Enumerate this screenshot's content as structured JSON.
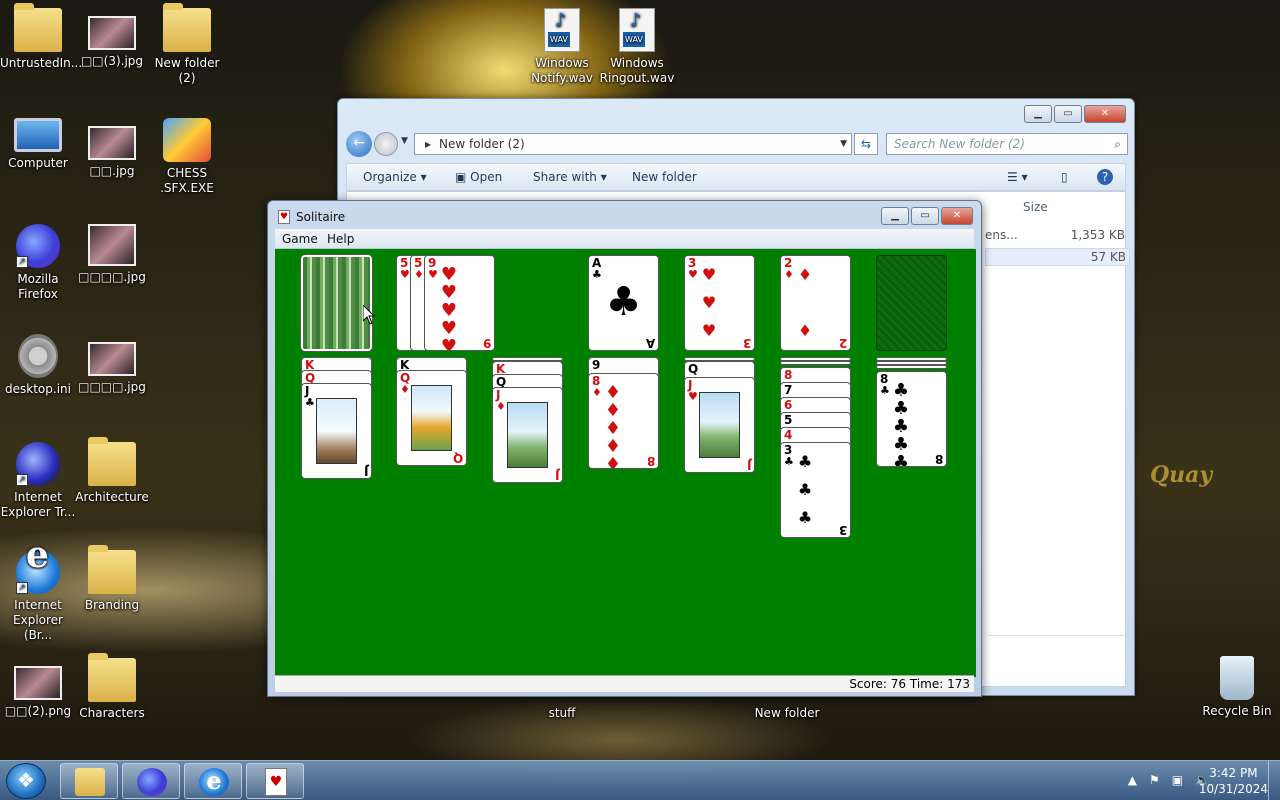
{
  "desktop": {
    "icons": [
      {
        "label": "UntrustedIn...",
        "icon": "folder-user-icon"
      },
      {
        "label": "□□(3).jpg",
        "icon": "image-file-icon"
      },
      {
        "label": "New folder (2)",
        "icon": "folder-icon"
      },
      {
        "label": "Windows Notify.wav",
        "icon": "wav-file-icon"
      },
      {
        "label": "Windows Ringout.wav",
        "icon": "wav-file-icon"
      },
      {
        "label": "Computer",
        "icon": "computer-icon"
      },
      {
        "label": "□□.jpg",
        "icon": "image-file-icon"
      },
      {
        "label": "CHESS .SFX.EXE",
        "icon": "installer-icon"
      },
      {
        "label": "Mozilla Firefox",
        "icon": "firefox-icon"
      },
      {
        "label": "□□□□.jpg",
        "icon": "image-file-icon"
      },
      {
        "label": "desktop.ini",
        "icon": "settings-file-icon"
      },
      {
        "label": "□□□□.jpg",
        "icon": "image-file-icon"
      },
      {
        "label": "Internet Explorer Tr...",
        "icon": "browser-shortcut-icon"
      },
      {
        "label": "Architecture",
        "icon": "folder-icon"
      },
      {
        "label": "Internet Explorer (Br...",
        "icon": "ie-icon"
      },
      {
        "label": "Branding",
        "icon": "folder-icon"
      },
      {
        "label": "□□(2).png",
        "icon": "image-file-icon"
      },
      {
        "label": "Characters",
        "icon": "folder-icon"
      },
      {
        "label": "stuff",
        "icon": "folder-icon"
      },
      {
        "label": "New folder",
        "icon": "folder-icon"
      },
      {
        "label": "Recycle Bin",
        "icon": "recycle-bin-icon"
      }
    ],
    "wallpaper_text": "Quay"
  },
  "explorer": {
    "address": "New folder (2)",
    "search_placeholder": "Search New folder (2)",
    "toolbar": {
      "organize": "Organize",
      "open": "Open",
      "share_with": "Share with",
      "new_folder": "New folder"
    },
    "columns": {
      "size": "Size"
    },
    "rows": [
      {
        "name": "ens...",
        "size": "1,353 KB"
      },
      {
        "name": "",
        "size": "57 KB"
      }
    ]
  },
  "solitaire": {
    "title": "Solitaire",
    "menu": {
      "game": "Game",
      "help": "Help"
    },
    "status": "Score: 76  Time: 173",
    "cards": {
      "waste_1": {
        "rank": "5",
        "suit": "♥"
      },
      "waste_2": {
        "rank": "5",
        "suit": "♦"
      },
      "waste_3": {
        "rank": "9",
        "suit": "♥"
      },
      "found_1": {
        "rank": "A",
        "suit": "♣"
      },
      "found_2": {
        "rank": "3",
        "suit": "♥"
      },
      "found_3": {
        "rank": "2",
        "suit": "♦"
      },
      "t1_a": {
        "rank": "K",
        "suit": "♥"
      },
      "t1_b": {
        "rank": "Q",
        "suit": "♥"
      },
      "t1_c": {
        "rank": "J",
        "suit": "♣"
      },
      "t2_a": {
        "rank": "K",
        "suit": "♣"
      },
      "t2_b": {
        "rank": "Q",
        "suit": "♦"
      },
      "t3_a": {
        "rank": "K",
        "suit": "♥"
      },
      "t3_b": {
        "rank": "Q",
        "suit": "♣"
      },
      "t3_c": {
        "rank": "J",
        "suit": "♦"
      },
      "t4_a": {
        "rank": "9",
        "suit": "♣"
      },
      "t4_b": {
        "rank": "8",
        "suit": "♦"
      },
      "t5_a": {
        "rank": "Q",
        "suit": "♠"
      },
      "t5_b": {
        "rank": "J",
        "suit": "♥"
      },
      "t6_a": {
        "rank": "8",
        "suit": "♥"
      },
      "t6_b": {
        "rank": "7",
        "suit": "♣"
      },
      "t6_c": {
        "rank": "6",
        "suit": "♥"
      },
      "t6_d": {
        "rank": "5",
        "suit": "♣"
      },
      "t6_e": {
        "rank": "4",
        "suit": "♥"
      },
      "t6_f": {
        "rank": "3",
        "suit": "♣"
      },
      "t7_a": {
        "rank": "8",
        "suit": "♣"
      }
    }
  },
  "taskbar": {
    "apps": [
      "file-explorer-icon",
      "firefox-icon",
      "ie-icon",
      "solitaire-icon"
    ],
    "time": "3:42 PM",
    "date": "10/31/2024"
  }
}
